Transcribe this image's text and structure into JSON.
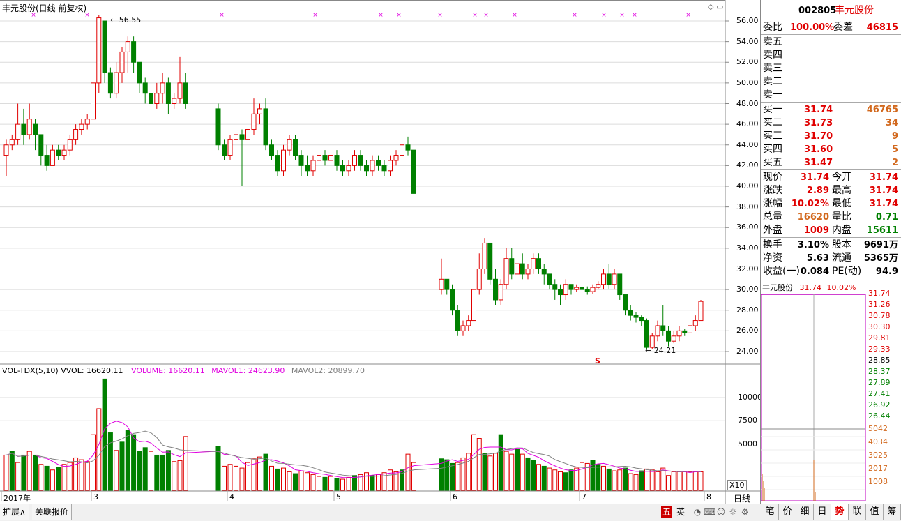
{
  "chart_title": "丰元股份(日线 前复权)",
  "price_chart": {
    "y_ticks": [
      "56.00",
      "54.00",
      "52.00",
      "50.00",
      "48.00",
      "46.00",
      "44.00",
      "42.00",
      "40.00",
      "38.00",
      "36.00",
      "34.00",
      "32.00",
      "30.00",
      "28.00",
      "26.00",
      "24.00"
    ],
    "high_label": "56.55",
    "low_label": "24.21",
    "marker_s": "S"
  },
  "volume_chart": {
    "indicator": "VOL-TDX(5,10)",
    "vvol": "VVOL: 16620.11",
    "volume": "VOLUME: 16620.11",
    "mavol1": "MAVOL1: 24623.90",
    "mavol2": "MAVOL2: 20899.70",
    "y_ticks": [
      "10000",
      "7500",
      "5000"
    ],
    "scale_label": "X10"
  },
  "x_axis": {
    "labels": [
      "2017年",
      "3",
      "4",
      "5",
      "6",
      "7",
      "8"
    ],
    "period": "日线"
  },
  "colors": {
    "up": "#e00000",
    "down": "#008000",
    "ma1": "#e000e0",
    "ma2": "#808080"
  },
  "quote": {
    "code": "002805",
    "name": "丰元股份",
    "weibi_label": "委比",
    "weibi": "100.00%",
    "weicha_label": "委差",
    "weicha": "46815",
    "sell": [
      {
        "label": "卖五",
        "price": "",
        "vol": ""
      },
      {
        "label": "卖四",
        "price": "",
        "vol": ""
      },
      {
        "label": "卖三",
        "price": "",
        "vol": ""
      },
      {
        "label": "卖二",
        "price": "",
        "vol": ""
      },
      {
        "label": "卖一",
        "price": "",
        "vol": ""
      }
    ],
    "buy": [
      {
        "label": "买一",
        "price": "31.74",
        "vol": "46765"
      },
      {
        "label": "买二",
        "price": "31.73",
        "vol": "34"
      },
      {
        "label": "买三",
        "price": "31.70",
        "vol": "9"
      },
      {
        "label": "买四",
        "price": "31.60",
        "vol": "5"
      },
      {
        "label": "买五",
        "price": "31.47",
        "vol": "2"
      }
    ],
    "stats": [
      {
        "l1": "现价",
        "v1": "31.74",
        "c1": "red",
        "l2": "今开",
        "v2": "31.74",
        "c2": "red"
      },
      {
        "l1": "涨跌",
        "v1": "2.89",
        "c1": "red",
        "l2": "最高",
        "v2": "31.74",
        "c2": "red"
      },
      {
        "l1": "涨幅",
        "v1": "10.02%",
        "c1": "red",
        "l2": "最低",
        "v2": "31.74",
        "c2": "red"
      },
      {
        "l1": "总量",
        "v1": "16620",
        "c1": "orange",
        "l2": "量比",
        "v2": "0.71",
        "c2": "green"
      },
      {
        "l1": "外盘",
        "v1": "1009",
        "c1": "red",
        "l2": "内盘",
        "v2": "15611",
        "c2": "green"
      }
    ],
    "fin": [
      {
        "l1": "换手",
        "v1": "3.10%",
        "l2": "股本",
        "v2": "9691万"
      },
      {
        "l1": "净资",
        "v1": "5.63",
        "l2": "流通",
        "v2": "5365万"
      },
      {
        "l1": "收益(一)",
        "v1": "0.084",
        "l2": "PE(动)",
        "v2": "94.9"
      }
    ]
  },
  "mini_chart": {
    "title": "丰元股份",
    "price": "31.74",
    "pct": "10.02%",
    "price_ticks": [
      "31.74",
      "31.26",
      "30.78",
      "30.30",
      "29.81",
      "29.33",
      "28.85",
      "28.37",
      "27.89",
      "27.41",
      "26.92",
      "26.44"
    ],
    "vol_ticks": [
      "5042",
      "4034",
      "3025",
      "2017",
      "1008"
    ]
  },
  "bottom": {
    "tab1": "扩展∧",
    "tab2": "关联报价",
    "right_tabs": [
      "笔",
      "价",
      "细",
      "日",
      "势",
      "联",
      "值",
      "筹"
    ],
    "active_tab": "势",
    "ime": [
      "五",
      "英"
    ]
  }
}
